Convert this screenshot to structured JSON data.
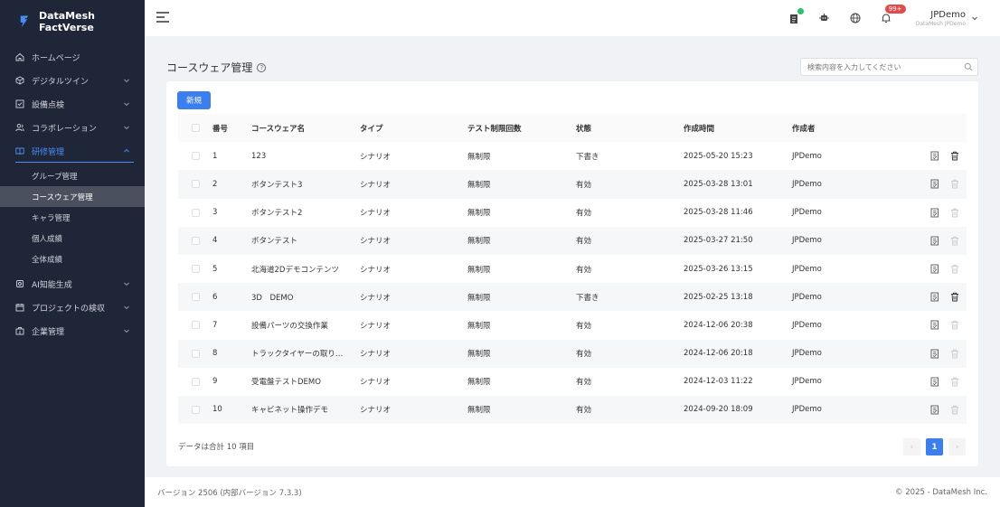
{
  "brand": {
    "name": "DataMesh FactVerse"
  },
  "sidebar": {
    "items": [
      {
        "label": "ホームページ",
        "icon": "home-icon",
        "has_chevron": false
      },
      {
        "label": "デジタルツイン",
        "icon": "cube-icon",
        "has_chevron": true
      },
      {
        "label": "設備点検",
        "icon": "checklist-icon",
        "has_chevron": true
      },
      {
        "label": "コラボレーション",
        "icon": "users-icon",
        "has_chevron": true
      },
      {
        "label": "研修管理",
        "icon": "book-icon",
        "has_chevron": true,
        "expanded": true
      }
    ],
    "sub_items": [
      {
        "label": "グループ管理"
      },
      {
        "label": "コースウェア管理",
        "selected": true
      },
      {
        "label": "キャラ管理"
      },
      {
        "label": "個人成績"
      },
      {
        "label": "全体成績"
      }
    ],
    "items_after": [
      {
        "label": "AI知能生成",
        "icon": "ai-icon"
      },
      {
        "label": "プロジェクトの検収",
        "icon": "calendar-icon"
      },
      {
        "label": "企業管理",
        "icon": "building-icon"
      }
    ]
  },
  "header": {
    "badge": "99+",
    "user_name": "JPDemo",
    "user_org": "DataMesh JPDemo"
  },
  "page": {
    "title": "コースウェア管理",
    "help": "?",
    "search_placeholder": "検索内容を入力してください",
    "new_button": "新規"
  },
  "table": {
    "headers": [
      "番号",
      "コースウェア名",
      "タイプ",
      "テスト制限回数",
      "状態",
      "作成時間",
      "作成者"
    ],
    "rows": [
      {
        "no": "1",
        "name": "123",
        "type": "シナリオ",
        "limit": "無制限",
        "status": "下書き",
        "time": "2025-05-20 15:23",
        "author": "JPDemo",
        "deletable": true
      },
      {
        "no": "2",
        "name": "ボタンテスト3",
        "type": "シナリオ",
        "limit": "無制限",
        "status": "有効",
        "time": "2025-03-28 13:01",
        "author": "JPDemo",
        "deletable": false
      },
      {
        "no": "3",
        "name": "ボタンテスト2",
        "type": "シナリオ",
        "limit": "無制限",
        "status": "有効",
        "time": "2025-03-28 11:46",
        "author": "JPDemo",
        "deletable": false
      },
      {
        "no": "4",
        "name": "ボタンテスト",
        "type": "シナリオ",
        "limit": "無制限",
        "status": "有効",
        "time": "2025-03-27 21:50",
        "author": "JPDemo",
        "deletable": false
      },
      {
        "no": "5",
        "name": "北海道2Dデモコンテンツ",
        "type": "シナリオ",
        "limit": "無制限",
        "status": "有効",
        "time": "2025-03-26 13:15",
        "author": "JPDemo",
        "deletable": false
      },
      {
        "no": "6",
        "name": "3D　DEMO",
        "type": "シナリオ",
        "limit": "無制限",
        "status": "下書き",
        "time": "2025-02-25 13:18",
        "author": "JPDemo",
        "deletable": true
      },
      {
        "no": "7",
        "name": "設備パーツの交換作業",
        "type": "シナリオ",
        "limit": "無制限",
        "status": "有効",
        "time": "2024-12-06 20:38",
        "author": "JPDemo",
        "deletable": false
      },
      {
        "no": "8",
        "name": "トラックタイヤーの取り…",
        "type": "シナリオ",
        "limit": "無制限",
        "status": "有効",
        "time": "2024-12-06 20:18",
        "author": "JPDemo",
        "deletable": false
      },
      {
        "no": "9",
        "name": "受電盤テストDEMO",
        "type": "シナリオ",
        "limit": "無制限",
        "status": "有効",
        "time": "2024-12-03 11:22",
        "author": "JPDemo",
        "deletable": false
      },
      {
        "no": "10",
        "name": "キャビネット操作デモ",
        "type": "シナリオ",
        "limit": "無制限",
        "status": "有効",
        "time": "2024-09-20 18:09",
        "author": "JPDemo",
        "deletable": false
      }
    ]
  },
  "pagination": {
    "total": "データは合計 10 項目",
    "current": "1",
    "prev": "‹",
    "next": "›"
  },
  "footer": {
    "version": "バージョン 2506 (内部バージョン 7.3.3)",
    "copyright": "© 2025 - DataMesh Inc."
  },
  "colors": {
    "sidebar_bg": "#1f2638",
    "accent": "#3b7ef0",
    "badge": "#e14b4b"
  }
}
